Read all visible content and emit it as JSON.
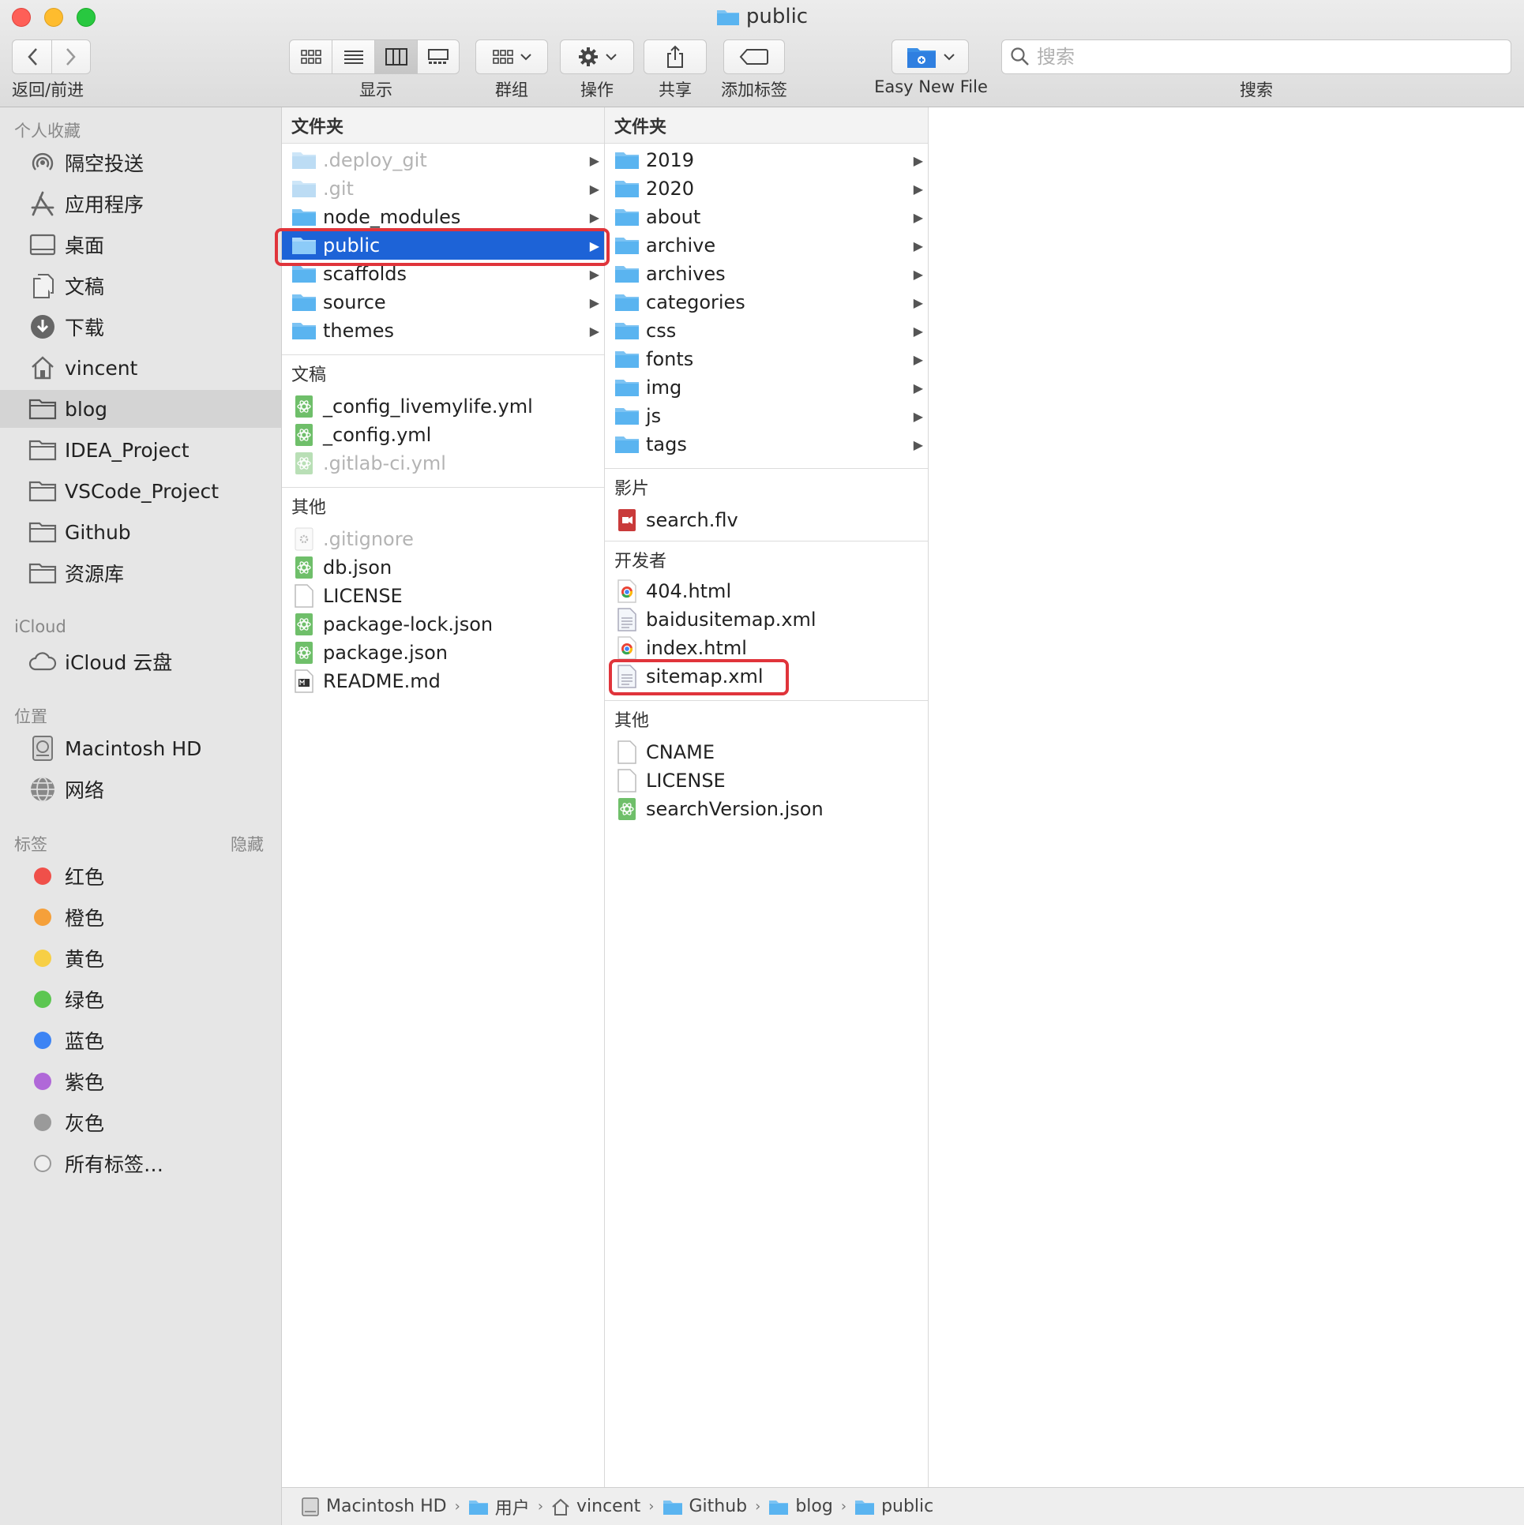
{
  "window": {
    "title": "public"
  },
  "toolbar": {
    "back_forward_label": "返回/前进",
    "view_label": "显示",
    "group_label": "群组",
    "action_label": "操作",
    "share_label": "共享",
    "tag_label": "添加标签",
    "easy_new_file_label": "Easy New File",
    "search_label": "搜索",
    "search_placeholder": "搜索"
  },
  "sidebar": {
    "favorites_header": "个人收藏",
    "favorites": [
      {
        "label": "隔空投送",
        "icon": "airdrop-icon"
      },
      {
        "label": "应用程序",
        "icon": "applications-icon"
      },
      {
        "label": "桌面",
        "icon": "desktop-icon"
      },
      {
        "label": "文稿",
        "icon": "documents-icon"
      },
      {
        "label": "下载",
        "icon": "downloads-icon"
      },
      {
        "label": "vincent",
        "icon": "home-icon"
      },
      {
        "label": "blog",
        "icon": "folder-icon",
        "selected": true
      },
      {
        "label": "IDEA_Project",
        "icon": "folder-icon"
      },
      {
        "label": "VSCode_Project",
        "icon": "folder-icon"
      },
      {
        "label": "Github",
        "icon": "folder-icon"
      },
      {
        "label": "资源库",
        "icon": "folder-icon"
      }
    ],
    "icloud_header": "iCloud",
    "icloud": [
      {
        "label": "iCloud 云盘",
        "icon": "cloud-icon"
      }
    ],
    "locations_header": "位置",
    "locations": [
      {
        "label": "Macintosh HD",
        "icon": "harddisk-icon"
      },
      {
        "label": "网络",
        "icon": "network-icon"
      }
    ],
    "tags_header": "标签",
    "tags_hide": "隐藏",
    "tags": [
      {
        "label": "红色",
        "color": "#f0504a"
      },
      {
        "label": "橙色",
        "color": "#f5a03a"
      },
      {
        "label": "黄色",
        "color": "#f7cf45"
      },
      {
        "label": "绿色",
        "color": "#5cc651"
      },
      {
        "label": "蓝色",
        "color": "#3d84f4"
      },
      {
        "label": "紫色",
        "color": "#b068d8"
      },
      {
        "label": "灰色",
        "color": "#9a9a9a"
      },
      {
        "label": "所有标签…",
        "color": "none"
      }
    ]
  },
  "column1": {
    "folders_header": "文件夹",
    "folders": [
      {
        "label": ".deploy_git",
        "dim": true
      },
      {
        "label": ".git",
        "dim": true
      },
      {
        "label": "node_modules"
      },
      {
        "label": "public",
        "selected": true
      },
      {
        "label": "scaffolds"
      },
      {
        "label": "source"
      },
      {
        "label": "themes"
      }
    ],
    "docs_header": "文稿",
    "docs": [
      {
        "label": "_config_livemylife.yml"
      },
      {
        "label": "_config.yml"
      },
      {
        "label": ".gitlab-ci.yml",
        "dim": true
      }
    ],
    "other_header": "其他",
    "other": [
      {
        "label": ".gitignore",
        "dim": true,
        "icon": "gear-file-icon"
      },
      {
        "label": "db.json",
        "icon": "atom-file-icon"
      },
      {
        "label": "LICENSE",
        "icon": "blank-file-icon"
      },
      {
        "label": "package-lock.json",
        "icon": "atom-file-icon"
      },
      {
        "label": "package.json",
        "icon": "atom-file-icon"
      },
      {
        "label": "README.md",
        "icon": "markdown-file-icon"
      }
    ]
  },
  "column2": {
    "folders_header": "文件夹",
    "folders": [
      "2019",
      "2020",
      "about",
      "archive",
      "archives",
      "categories",
      "css",
      "fonts",
      "img",
      "js",
      "tags"
    ],
    "movies_header": "影片",
    "movies": [
      {
        "label": "search.flv"
      }
    ],
    "developer_header": "开发者",
    "developer": [
      {
        "label": "404.html",
        "icon": "chrome-html-icon"
      },
      {
        "label": "baidusitemap.xml",
        "icon": "xml-file-icon"
      },
      {
        "label": "index.html",
        "icon": "chrome-html-icon"
      },
      {
        "label": "sitemap.xml",
        "icon": "xml-file-icon",
        "highlighted": true
      }
    ],
    "other_header": "其他",
    "other": [
      {
        "label": "CNAME",
        "icon": "blank-file-icon"
      },
      {
        "label": "LICENSE",
        "icon": "blank-file-icon"
      },
      {
        "label": "searchVersion.json",
        "icon": "atom-file-icon"
      }
    ]
  },
  "pathbar": [
    {
      "label": "Macintosh HD",
      "icon": "harddisk-icon"
    },
    {
      "label": "用户",
      "icon": "folder-icon"
    },
    {
      "label": "vincent",
      "icon": "home-icon"
    },
    {
      "label": "Github",
      "icon": "folder-icon"
    },
    {
      "label": "blog",
      "icon": "folder-icon"
    },
    {
      "label": "public",
      "icon": "folder-icon"
    }
  ],
  "colors": {
    "selection": "#1d63d7",
    "highlight_box": "#e0343b",
    "folder": "#5ab4f0"
  }
}
